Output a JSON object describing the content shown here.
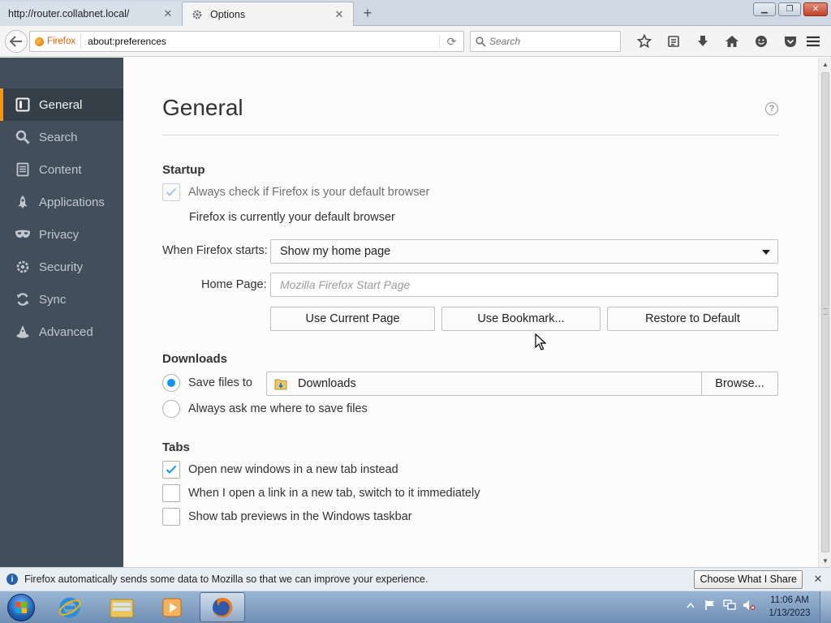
{
  "browser": {
    "tabs": [
      {
        "title": "http://router.collabnet.local/",
        "active": false
      },
      {
        "title": "Options",
        "active": true
      }
    ],
    "identity_label": "Firefox",
    "url": "about:preferences",
    "search_placeholder": "Search"
  },
  "sidebar": {
    "items": [
      {
        "label": "General",
        "icon": "general-icon",
        "selected": true
      },
      {
        "label": "Search",
        "icon": "search-icon",
        "selected": false
      },
      {
        "label": "Content",
        "icon": "content-icon",
        "selected": false
      },
      {
        "label": "Applications",
        "icon": "applications-icon",
        "selected": false
      },
      {
        "label": "Privacy",
        "icon": "privacy-mask-icon",
        "selected": false
      },
      {
        "label": "Security",
        "icon": "security-lock-icon",
        "selected": false
      },
      {
        "label": "Sync",
        "icon": "sync-icon",
        "selected": false
      },
      {
        "label": "Advanced",
        "icon": "advanced-wizard-icon",
        "selected": false
      }
    ]
  },
  "main": {
    "title": "General",
    "startup": {
      "heading": "Startup",
      "default_check_label": "Always check if Firefox is your default browser",
      "default_check_checked": true,
      "default_status": "Firefox is currently your default browser",
      "when_starts_label": "When Firefox starts:",
      "when_starts_value": "Show my home page",
      "home_page_label": "Home Page:",
      "home_page_placeholder": "Mozilla Firefox Start Page",
      "use_current_label": "Use Current Page",
      "use_bookmark_label": "Use Bookmark...",
      "restore_default_label": "Restore to Default"
    },
    "downloads": {
      "heading": "Downloads",
      "save_files_label": "Save files to",
      "save_files_selected": true,
      "folder_name": "Downloads",
      "browse_label": "Browse...",
      "always_ask_label": "Always ask me where to save files",
      "always_ask_selected": false
    },
    "tabs": {
      "heading": "Tabs",
      "options": [
        {
          "label": "Open new windows in a new tab instead",
          "checked": true
        },
        {
          "label": "When I open a link in a new tab, switch to it immediately",
          "checked": false
        },
        {
          "label": "Show tab previews in the Windows taskbar",
          "checked": false
        }
      ]
    }
  },
  "notification": {
    "text": "Firefox automatically sends some data to Mozilla so that we can improve your experience.",
    "button_label": "Choose What I Share"
  },
  "taskbar": {
    "apps": [
      "internet-explorer-icon",
      "file-explorer-icon",
      "media-player-icon",
      "firefox-icon"
    ],
    "time": "11:06 AM",
    "date": "1/13/2023"
  },
  "colors": {
    "sidebar_bg": "#424f5a",
    "sidebar_selected": "#343f48",
    "selection_accent": "#ff9500",
    "check_blue": "#0996f8"
  }
}
